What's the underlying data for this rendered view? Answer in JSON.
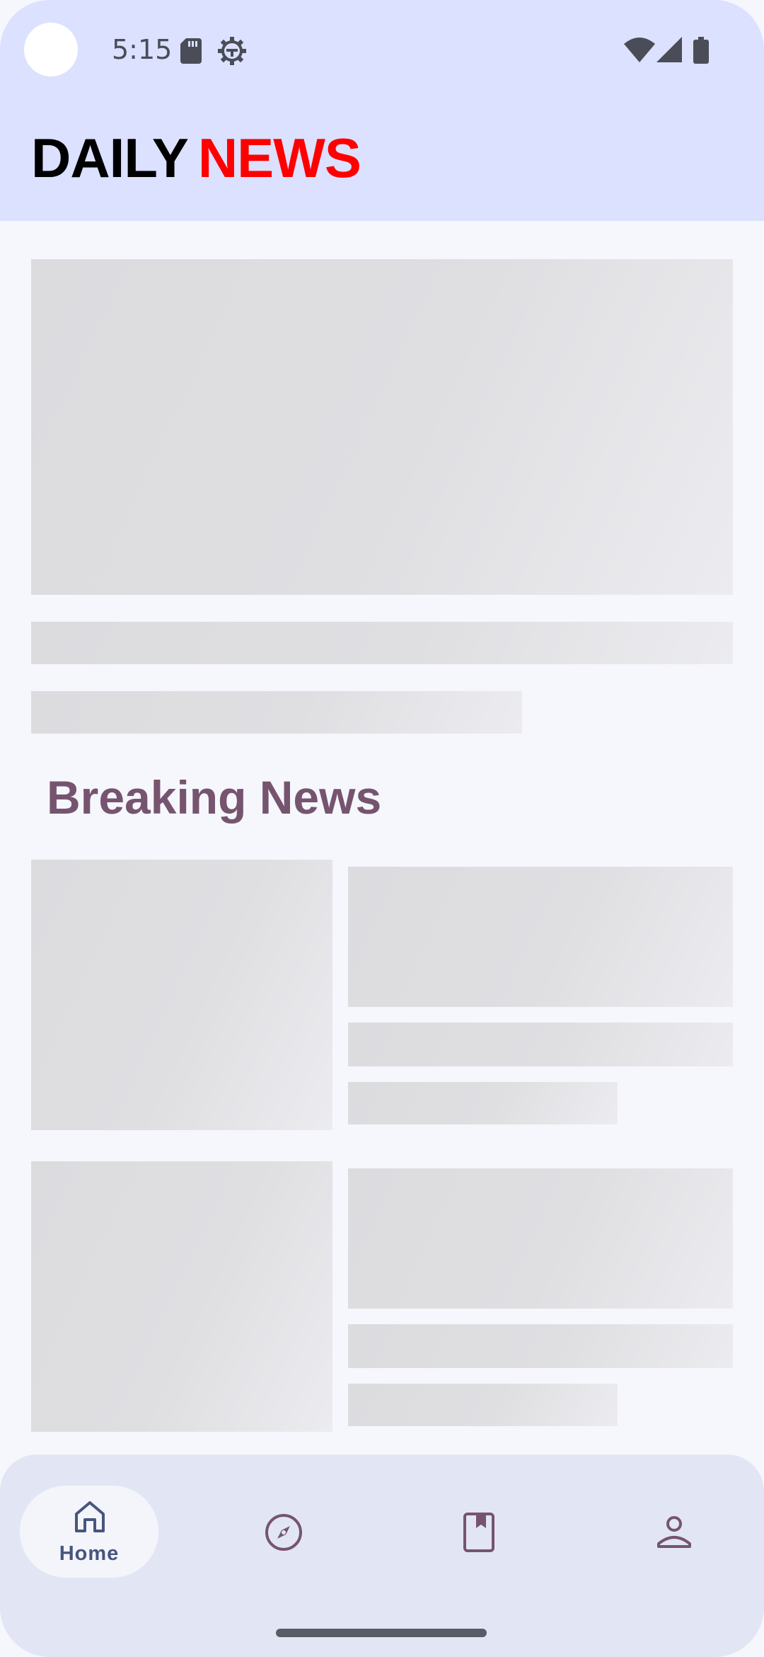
{
  "status_bar": {
    "time": "5:15",
    "icons": [
      "sd-card-icon",
      "gear-icon",
      "wifi-icon",
      "signal-icon",
      "battery-icon"
    ]
  },
  "app_bar": {
    "brand_part1": "DAILY",
    "brand_part2": "NEWS"
  },
  "sections": {
    "breaking_title": "Breaking News"
  },
  "bottom_nav": {
    "items": [
      {
        "label": "Home",
        "icon": "home-icon",
        "selected": true
      },
      {
        "label": "",
        "icon": "compass-icon",
        "selected": false
      },
      {
        "label": "",
        "icon": "bookmark-icon",
        "selected": false
      },
      {
        "label": "",
        "icon": "profile-icon",
        "selected": false
      }
    ]
  },
  "colors": {
    "header_bg": "#dbe1ff",
    "page_bg": "#f6f7fd",
    "brand_red": "#ff0000",
    "section_title": "#76546f",
    "nav_bg": "#e2e6f4"
  }
}
